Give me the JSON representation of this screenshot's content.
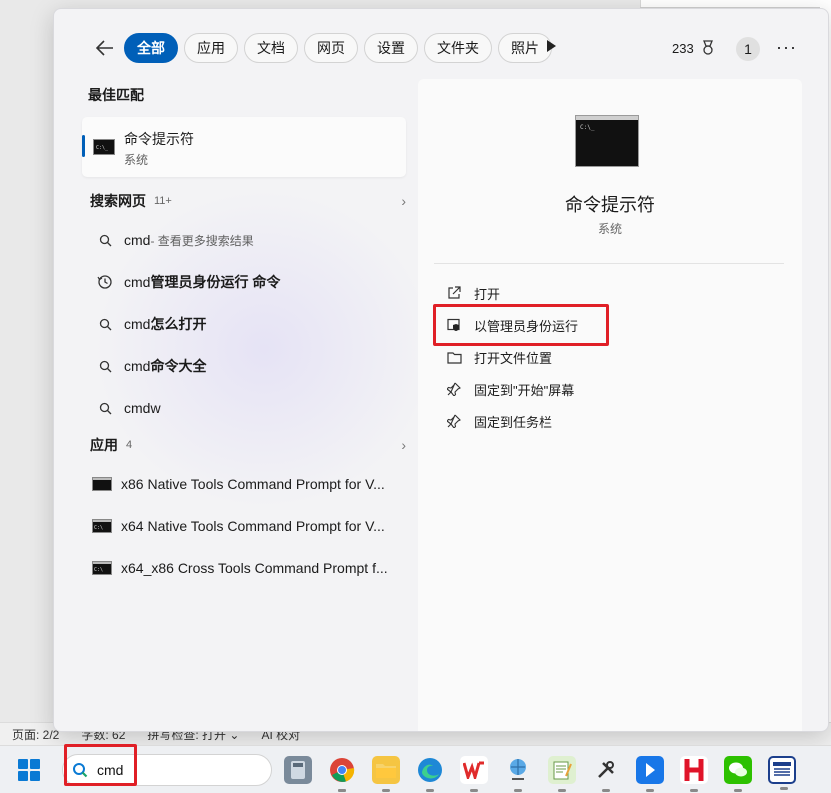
{
  "statusbar": {
    "page": "页面: 2/2",
    "words": "字数: 62",
    "spell": "拼写检查: 打开 ⌄",
    "ai": "AI 校对"
  },
  "topbar": {
    "filters": [
      "全部",
      "应用",
      "文档",
      "网页",
      "设置",
      "文件夹",
      "照片"
    ],
    "active_filter": "全部",
    "points": "233",
    "avatar": "1",
    "more": "···"
  },
  "left": {
    "best_match_title": "最佳匹配",
    "best_match": {
      "name": "命令提示符",
      "sub": "系统"
    },
    "web_title": "搜索网页",
    "web_count": "11+",
    "web_items": [
      {
        "icon": "search-icon",
        "main": "cmd",
        "light": " - 查看更多搜索结果",
        "bold": ""
      },
      {
        "icon": "history-icon",
        "main": "cmd",
        "light": "",
        "bold": "管理员身份运行 命令"
      },
      {
        "icon": "search-icon",
        "main": "cmd",
        "light": "",
        "bold": "怎么打开"
      },
      {
        "icon": "search-icon",
        "main": "cmd",
        "light": "",
        "bold": "命令大全"
      },
      {
        "icon": "search-icon",
        "main": "cmdw",
        "light": "",
        "bold": ""
      }
    ],
    "apps_title": "应用",
    "apps_count": "4",
    "apps": [
      "x86 Native Tools Command Prompt for V...",
      "x64 Native Tools Command Prompt for V...",
      "x64_x86 Cross Tools Command Prompt f..."
    ]
  },
  "right": {
    "title": "命令提示符",
    "sub": "系统",
    "actions": [
      {
        "icon": "open-icon",
        "label": "打开"
      },
      {
        "icon": "shield-icon",
        "label": "以管理员身份运行"
      },
      {
        "icon": "folder-icon",
        "label": "打开文件位置"
      },
      {
        "icon": "pin-icon",
        "label": "固定到\"开始\"屏幕"
      },
      {
        "icon": "pin-icon",
        "label": "固定到任务栏"
      }
    ]
  },
  "taskbar": {
    "search_value": "cmd",
    "icons": [
      "calculator-icon",
      "chrome-icon",
      "file-explorer-icon",
      "edge-icon",
      "wps-icon",
      "globe-icon",
      "notepad-icon",
      "tools-icon",
      "blue-app-icon",
      "h-app-icon",
      "wechat-icon",
      "news-icon"
    ]
  },
  "colors": {
    "accent": "#005fb8",
    "highlight": "#e01f26"
  }
}
